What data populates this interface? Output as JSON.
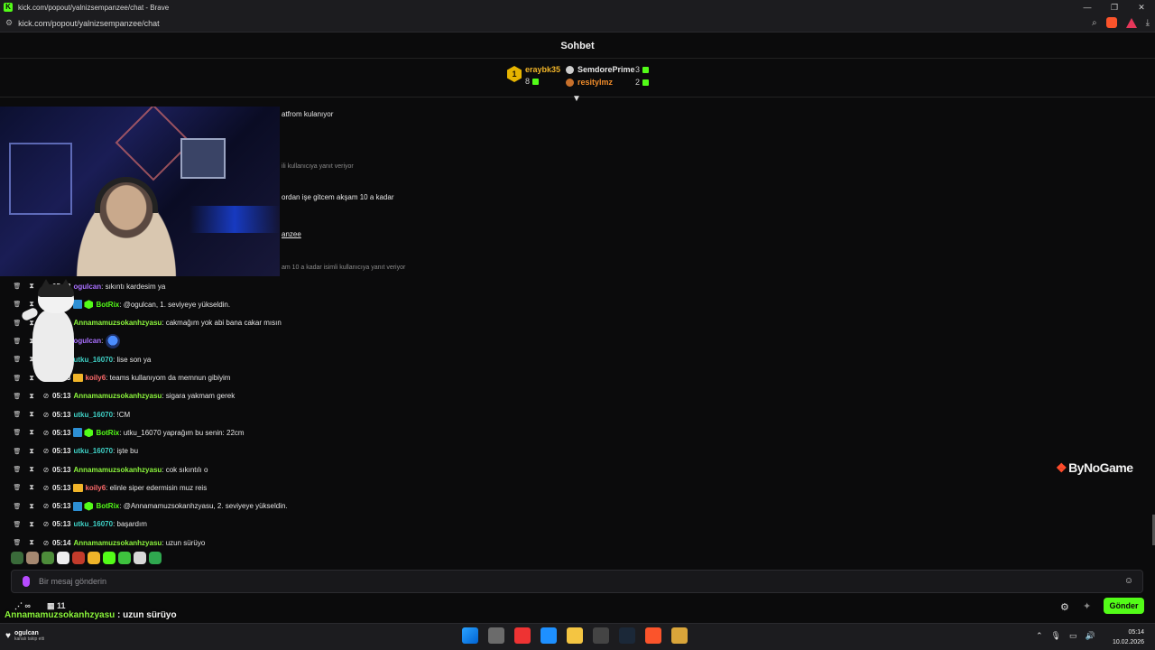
{
  "browser": {
    "title": "kick.com/popout/yalnizsempanzee/chat - Brave",
    "url": "kick.com/popout/yalnizsempanzee/chat"
  },
  "chat": {
    "header": "Sohbet",
    "top_gifters": [
      {
        "rank": "1",
        "name": "eraybk35",
        "count": "8",
        "color": "#f0b429"
      },
      {
        "name": "SemdorePrime",
        "count": "3",
        "color": "#e6e6e6"
      },
      {
        "name": "resitylmz",
        "count": "2",
        "color": "#f08c2b"
      }
    ],
    "partial_lines": [
      {
        "text": "atfrom kulanıyor",
        "kind": "text"
      },
      {
        "text": "ili kullanıcıya yanıt veriyor",
        "kind": "reply"
      },
      {
        "text": "ordan işe gitcem akşam 10 a kadar",
        "kind": "text"
      },
      {
        "text": "anzee",
        "kind": "link"
      },
      {
        "text": "am 10 a kadar isimli kullanıcıya yanıt veriyor",
        "kind": "reply"
      }
    ],
    "messages": [
      {
        "time": "05:13",
        "user": "ogulcan",
        "color": "#a970ff",
        "text": ": sıkıntı kardesim ya",
        "badges": []
      },
      {
        "time": "05:13",
        "user": "BotRix",
        "color": "#53fc18",
        "text": ": @ogulcan, 1. seviyeye yükseldin.",
        "badges": [
          "blue",
          "green"
        ]
      },
      {
        "time": "05:13",
        "user": "Annamamuzsokanhzyasu",
        "color": "#8bf53c",
        "text": ": cakmağım yok abi bana cakar mısın",
        "badges": []
      },
      {
        "time": "05:13",
        "user": "ogulcan",
        "color": "#a970ff",
        "text": ": ",
        "badges": [],
        "emote": true
      },
      {
        "time": "05:13",
        "user": "utku_16070",
        "color": "#3fd1c6",
        "text": ": lise son ya",
        "badges": []
      },
      {
        "time": "05:13",
        "user": "koily6",
        "color": "#ff6b6b",
        "text": ": teams kullanıyom da memnun gibiyim",
        "badges": [
          "crown"
        ]
      },
      {
        "time": "05:13",
        "user": "Annamamuzsokanhzyasu",
        "color": "#8bf53c",
        "text": ": sigara yakmam gerek",
        "badges": []
      },
      {
        "time": "05:13",
        "user": "utku_16070",
        "color": "#3fd1c6",
        "text": ": !CM",
        "badges": []
      },
      {
        "time": "05:13",
        "user": "BotRix",
        "color": "#53fc18",
        "text": ": utku_16070 yaprağım bu senin: 22cm",
        "badges": [
          "blue",
          "green"
        ]
      },
      {
        "time": "05:13",
        "user": "utku_16070",
        "color": "#3fd1c6",
        "text": ": işte bu",
        "badges": []
      },
      {
        "time": "05:13",
        "user": "Annamamuzsokanhzyasu",
        "color": "#8bf53c",
        "text": ": cok sıkıntılı o",
        "badges": []
      },
      {
        "time": "05:13",
        "user": "koily6",
        "color": "#ff6b6b",
        "text": ": elinle siper edermisin muz reis",
        "badges": [
          "crown"
        ]
      },
      {
        "time": "05:13",
        "user": "BotRix",
        "color": "#53fc18",
        "text": ": @Annamamuzsokanhzyasu, 2. seviyeye yükseldin.",
        "badges": [
          "blue",
          "green"
        ]
      },
      {
        "time": "05:13",
        "user": "utku_16070",
        "color": "#3fd1c6",
        "text": ": başardım",
        "badges": []
      },
      {
        "time": "05:14",
        "user": "Annamamuzsokanhzyasu",
        "color": "#8bf53c",
        "text": ": uzun sürüyo",
        "badges": []
      }
    ],
    "input_placeholder": "Bir mesaj gönderin",
    "infinity": "∞",
    "count_label": "11",
    "send_label": "Gönder"
  },
  "overlay": {
    "caption_name": "Annamamuzsokanhzyasu",
    "caption_text": " : uzun sürüyo",
    "watermark": "ByNoGame",
    "follower_name": "ogulcan",
    "follower_sub": "kanalı takip etti"
  },
  "taskbar": {
    "time": "05:14",
    "date": "10.02.2026"
  },
  "colors": {
    "accent": "#53fc18",
    "background": "#0b0b0c"
  }
}
